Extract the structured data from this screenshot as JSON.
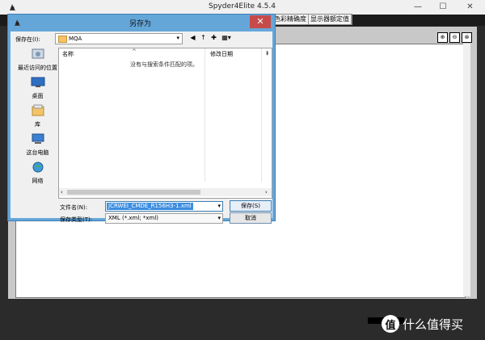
{
  "app": {
    "title": "Spyder4Elite 4.5.4",
    "window_buttons": {
      "minimize": "—",
      "maximize": "☐",
      "close": "✕"
    },
    "tabs": [
      "色彩精确度",
      "显示器额定值"
    ],
    "zoom_tools": [
      "⊕",
      "⊖",
      "⊗"
    ]
  },
  "dialog": {
    "title": "另存为",
    "close_glyph": "✕",
    "save_in_label": "保存在(I):",
    "save_in_value": "MQA",
    "nav_tools": [
      "◀",
      "↑",
      "✚",
      "▦▾"
    ],
    "places": [
      "最近访问的位置",
      "桌面",
      "库",
      "这台电脑",
      "网络"
    ],
    "columns": {
      "name": "名称",
      "sort_indicator": "^",
      "date": "修改日期",
      "more": "‡"
    },
    "empty_message": "没有与搜索条件匹配的项。",
    "filename_label": "文件名(N):",
    "filename_value": "JCRWEI_CMDE_R156H3-1.xml",
    "filetype_label": "保存类型(T):",
    "filetype_value": "XML (*.xml; *xml)",
    "save_button": "保存(S)",
    "cancel_button": "取消"
  },
  "watermark": {
    "badge": "值",
    "text": "什么值得买"
  },
  "colors": {
    "dialog_frame": "#65a6d9",
    "close_red": "#c74b4b",
    "selection_blue": "#3c8de0"
  }
}
